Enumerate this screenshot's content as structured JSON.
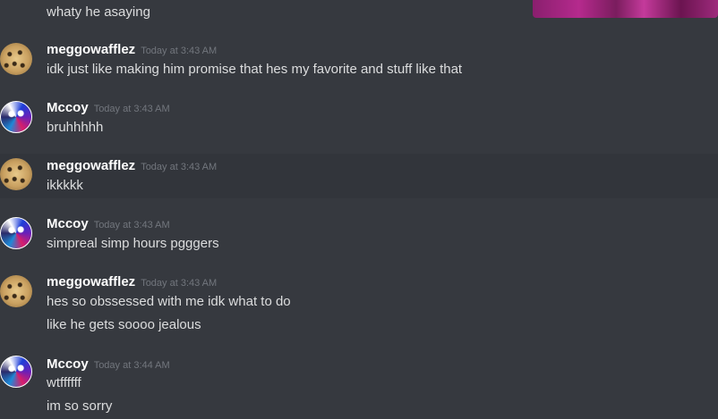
{
  "partial_message": "whaty he asaying",
  "messages": [
    {
      "author": "meggowafflez",
      "time": "Today at 3:43 AM",
      "lines": [
        "idk just like making him promise that hes my favorite and stuff like that"
      ]
    },
    {
      "author": "Mccoy",
      "time": "Today at 3:43 AM",
      "lines": [
        "bruhhhhh"
      ]
    },
    {
      "author": "meggowafflez",
      "time": "Today at 3:43 AM",
      "lines": [
        "ikkkkk"
      ]
    },
    {
      "author": "Mccoy",
      "time": "Today at 3:43 AM",
      "lines": [
        "simpreal simp hours pgggers"
      ]
    },
    {
      "author": "meggowafflez",
      "time": "Today at 3:43 AM",
      "lines": [
        "hes so obssessed with me idk what to do",
        "like he gets soooo jealous"
      ]
    },
    {
      "author": "Mccoy",
      "time": "Today at 3:44 AM",
      "lines": [
        "wtffffff",
        "im so sorry"
      ]
    }
  ],
  "colors": {
    "background": "#36393f",
    "hover_background": "#32353b",
    "username": "#ffffff",
    "message_text": "#dcddde",
    "timestamp": "#72767d"
  },
  "icons": {
    "meggowafflez_avatar": "cheetah-avatar-icon",
    "mccoy_avatar": "anime-art-avatar-icon"
  }
}
